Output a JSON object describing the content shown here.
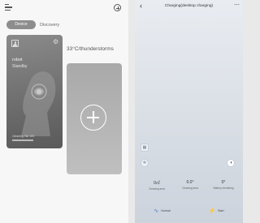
{
  "left_screen": {
    "header": {
      "menu_icon": "menu-icon",
      "add_icon": "add-circle-icon"
    },
    "tabs": [
      {
        "label": "Device",
        "active": true
      },
      {
        "label": "Discovery",
        "active": false
      }
    ],
    "device_card": {
      "name": "robot",
      "status": "Standby",
      "footer": "Cleaning Tab 100"
    },
    "weather": "33°C/thunderstorms",
    "add_device_icon": "plus-icon"
  },
  "right_screen": {
    "header": {
      "title": "Charging(desktop charging)",
      "back_icon": "back-arrow-icon",
      "more_icon": "more-icon"
    },
    "stats": [
      {
        "value": "0㎡",
        "label": "Cleaning area"
      },
      {
        "value": "0.0°",
        "label": "Cleaning area"
      },
      {
        "value": "0°",
        "label": "Battery remaining"
      }
    ],
    "bottom_bar": [
      {
        "icon": "wave-icon",
        "label": "Normal"
      },
      {
        "icon": "lightning-icon",
        "label": "Start"
      }
    ]
  },
  "colors": {
    "accent": "#4a78c8",
    "card_gray": "#7a7a7a",
    "tab_active": "#8d8d8d"
  }
}
